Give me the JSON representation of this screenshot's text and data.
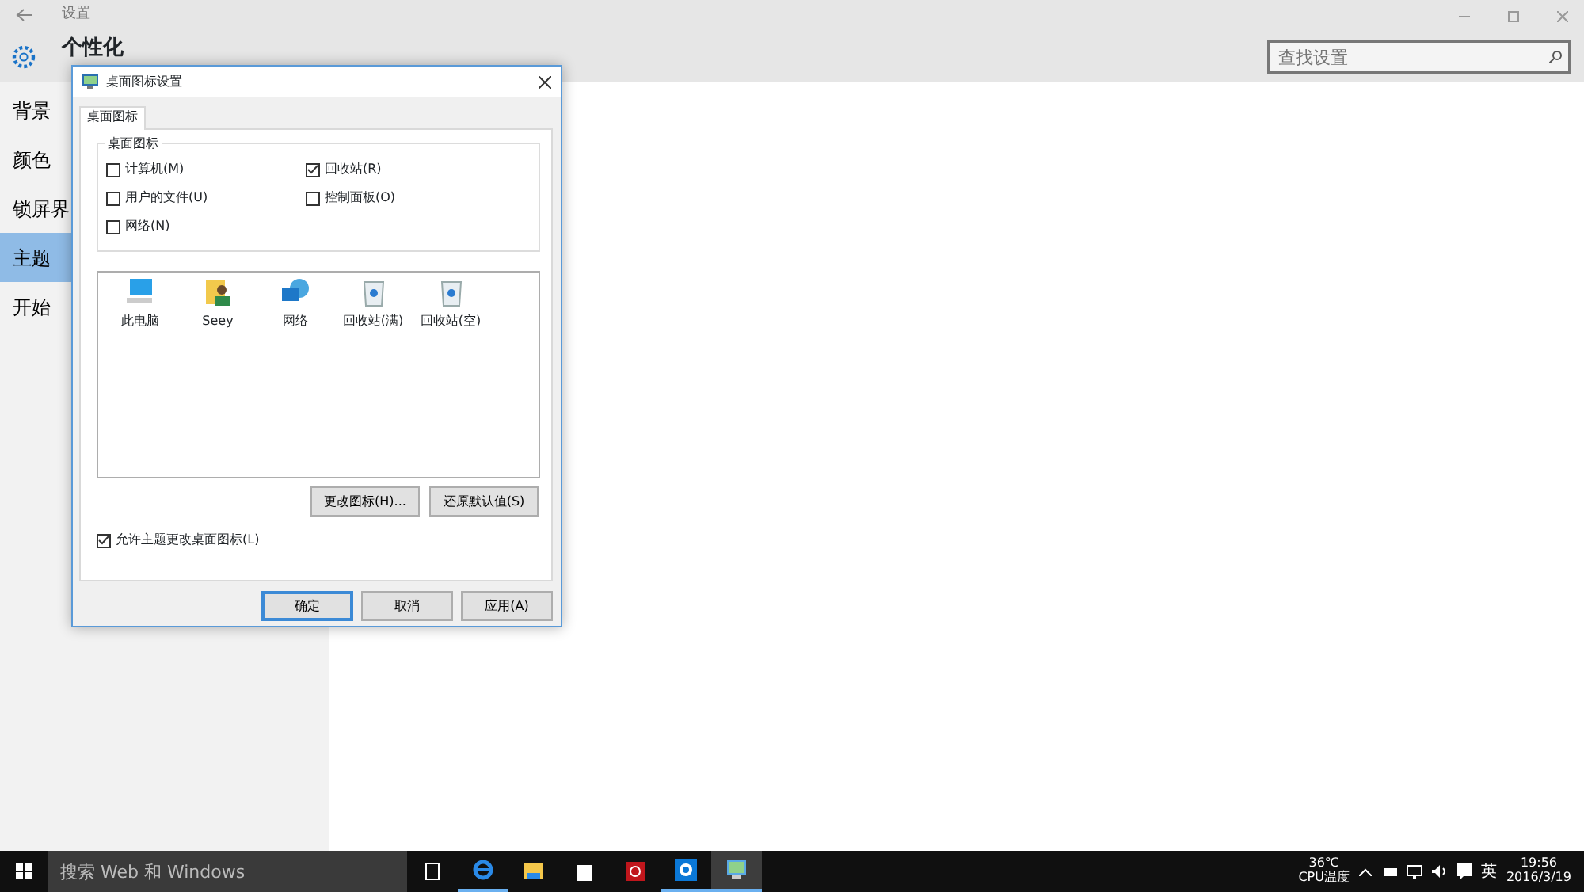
{
  "window": {
    "title": "设置",
    "header": "个性化",
    "search": {
      "placeholder": "查找设置"
    }
  },
  "sidebar": {
    "items": [
      {
        "label": "背景",
        "selected": false
      },
      {
        "label": "颜色",
        "selected": false
      },
      {
        "label": "锁屏界",
        "selected": false
      },
      {
        "label": "主题",
        "selected": true
      },
      {
        "label": "开始",
        "selected": false
      }
    ]
  },
  "dialog": {
    "title": "桌面图标设置",
    "tabs": [
      {
        "label": "桌面图标",
        "selected": true
      }
    ],
    "group": {
      "title": "桌面图标",
      "checkboxes": [
        {
          "label": "计算机(M)",
          "checked": false
        },
        {
          "label": "回收站(R)",
          "checked": true
        },
        {
          "label": "用户的文件(U)",
          "checked": false
        },
        {
          "label": "控制面板(O)",
          "checked": false
        },
        {
          "label": "网络(N)",
          "checked": false
        }
      ]
    },
    "icons": [
      {
        "kind": "computer",
        "label": "此电脑",
        "selected": false
      },
      {
        "kind": "user",
        "label": "Seey",
        "selected": false
      },
      {
        "kind": "network",
        "label": "网络",
        "selected": false
      },
      {
        "kind": "bin",
        "label": "回收站(满)",
        "selected": false
      },
      {
        "kind": "bin",
        "label": "回收站(空)",
        "selected": false
      }
    ],
    "icon_buttons": [
      "更改图标(H)...",
      "还原默认值(S)"
    ],
    "allow_themes": {
      "label": "允许主题更改桌面图标(L)",
      "checked": true
    },
    "buttons": [
      {
        "label": "确定",
        "default": true
      },
      {
        "label": "取消",
        "default": false
      },
      {
        "label": "应用(A)",
        "default": false
      }
    ]
  },
  "taskbar": {
    "search": {
      "placeholder": "搜索 Web 和 Windows"
    },
    "apps": [
      {
        "kind": "taskview",
        "active": false,
        "running": false
      },
      {
        "kind": "edge",
        "active": false,
        "running": true
      },
      {
        "kind": "folder",
        "active": false,
        "running": false
      },
      {
        "kind": "store",
        "active": false,
        "running": false
      },
      {
        "kind": "red",
        "active": false,
        "running": false
      },
      {
        "kind": "settings",
        "active": false,
        "running": true
      },
      {
        "kind": "monitor",
        "active": true,
        "running": true
      }
    ],
    "temperature": "36℃",
    "temperature_label": "CPU温度",
    "ime": "英",
    "time": "19:56",
    "date": "2016/3/19"
  }
}
